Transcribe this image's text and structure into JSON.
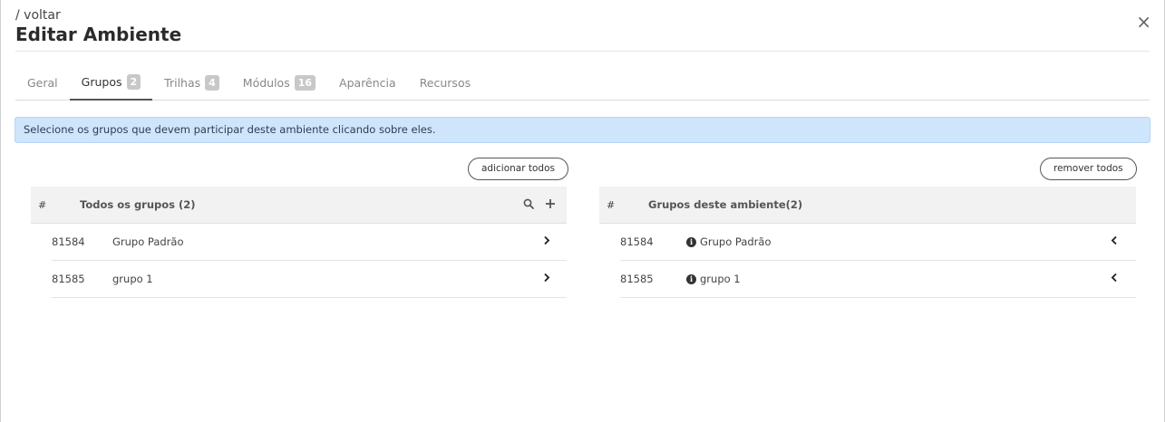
{
  "header": {
    "back_label": "/ voltar",
    "title": "Editar Ambiente",
    "close_label": "×"
  },
  "tabs": [
    {
      "label": "Geral",
      "badge": ""
    },
    {
      "label": "Grupos",
      "badge": "2"
    },
    {
      "label": "Trilhas",
      "badge": "4"
    },
    {
      "label": "Módulos",
      "badge": "16"
    },
    {
      "label": "Aparência",
      "badge": ""
    },
    {
      "label": "Recursos",
      "badge": ""
    }
  ],
  "alert": {
    "text": "Selecione os grupos que devem participar deste ambiente clicando sobre eles."
  },
  "left": {
    "button_label": "adicionar todos",
    "hash": "#",
    "title": "Todos os grupos (2)",
    "rows": [
      {
        "id": "81584",
        "name": "Grupo Padrão"
      },
      {
        "id": "81585",
        "name": "grupo 1"
      }
    ]
  },
  "right": {
    "button_label": "remover todos",
    "hash": "#",
    "title": "Grupos deste ambiente(2)",
    "rows": [
      {
        "id": "81584",
        "name": "Grupo Padrão"
      },
      {
        "id": "81585",
        "name": "grupo 1"
      }
    ]
  },
  "icons": {
    "search": "search-icon",
    "add": "plus-icon",
    "move_right": "chevron-right-icon",
    "move_left": "chevron-left-icon",
    "info": "info-icon"
  },
  "colors": {
    "alert_bg": "#cfe5fb",
    "header_bg": "#f2f2f2",
    "badge_bg": "#c8c8c8"
  }
}
